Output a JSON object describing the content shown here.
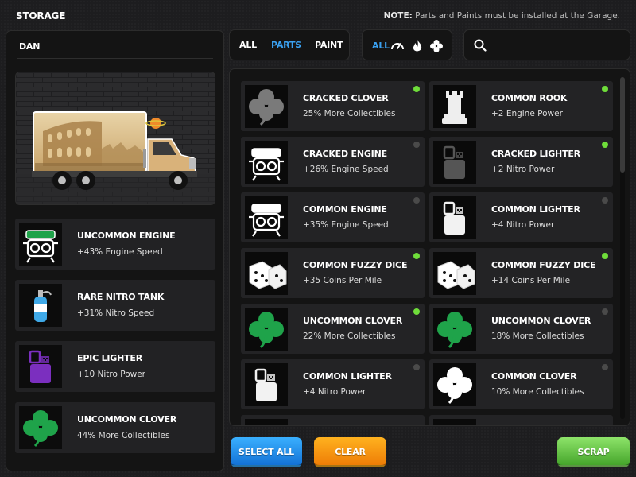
{
  "header": {
    "title": "STORAGE",
    "note_label": "NOTE:",
    "note_text": "Parts and Paints must be installed at the Garage."
  },
  "player": {
    "name": "DAN"
  },
  "equipped": [
    {
      "name": "UNCOMMON ENGINE",
      "desc": "+43% Engine Speed",
      "icon": "engine-icon",
      "color": "#1fa34a"
    },
    {
      "name": "RARE NITRO TANK",
      "desc": "+31% Nitro Speed",
      "icon": "nitro-tank-icon",
      "color": "#3fa9e8"
    },
    {
      "name": "EPIC LIGHTER",
      "desc": "+10 Nitro Power",
      "icon": "lighter-icon",
      "color": "#7b2fbf"
    },
    {
      "name": "UNCOMMON CLOVER",
      "desc": "44% More Collectibles",
      "icon": "clover-icon",
      "color": "#1fa34a"
    }
  ],
  "type_tabs": [
    {
      "label": "ALL",
      "active": false
    },
    {
      "label": "PARTS",
      "active": true
    },
    {
      "label": "PAINT",
      "active": false
    }
  ],
  "category_tabs": {
    "all_label": "ALL",
    "icons": [
      "speedometer-icon",
      "flame-icon",
      "clover-icon"
    ]
  },
  "search": {
    "placeholder": "",
    "value": ""
  },
  "inventory": [
    {
      "name": "CRACKED CLOVER",
      "desc": "25% More Collectibles",
      "icon": "clover-icon",
      "color": "#7a7a7a",
      "installed": true
    },
    {
      "name": "COMMON ROOK",
      "desc": "+2 Engine Power",
      "icon": "rook-icon",
      "color": "#eeeeee",
      "installed": true
    },
    {
      "name": "CRACKED ENGINE",
      "desc": "+26% Engine Speed",
      "icon": "engine-icon",
      "color": "#ffffff",
      "installed": false
    },
    {
      "name": "CRACKED LIGHTER",
      "desc": "+2 Nitro Power",
      "icon": "lighter-icon",
      "color": "#555555",
      "installed": true
    },
    {
      "name": "COMMON ENGINE",
      "desc": "+35% Engine Speed",
      "icon": "engine-icon",
      "color": "#ffffff",
      "installed": false
    },
    {
      "name": "COMMON LIGHTER",
      "desc": "+4 Nitro Power",
      "icon": "lighter-icon",
      "color": "#f2f2f2",
      "installed": false
    },
    {
      "name": "COMMON FUZZY DICE",
      "desc": "+35 Coins Per Mile",
      "icon": "dice-icon",
      "color": "#ffffff",
      "installed": true
    },
    {
      "name": "COMMON FUZZY DICE",
      "desc": "+14 Coins Per Mile",
      "icon": "dice-icon",
      "color": "#ffffff",
      "installed": true
    },
    {
      "name": "UNCOMMON CLOVER",
      "desc": "22% More Collectibles",
      "icon": "clover-icon",
      "color": "#1fa34a",
      "installed": true
    },
    {
      "name": "UNCOMMON CLOVER",
      "desc": "18% More Collectibles",
      "icon": "clover-icon",
      "color": "#1fa34a",
      "installed": false
    },
    {
      "name": "COMMON LIGHTER",
      "desc": "+4 Nitro Power",
      "icon": "lighter-icon",
      "color": "#f2f2f2",
      "installed": false
    },
    {
      "name": "COMMON CLOVER",
      "desc": "10% More Collectibles",
      "icon": "clover-icon",
      "color": "#ffffff",
      "installed": false
    }
  ],
  "buttons": {
    "select_all": "SELECT ALL",
    "clear": "CLEAR",
    "scrap": "SCRAP"
  },
  "colors": {
    "accent_blue": "#3aa0f0",
    "installed_green": "#6fdd3a",
    "inactive_dot": "#4a4a4a"
  }
}
